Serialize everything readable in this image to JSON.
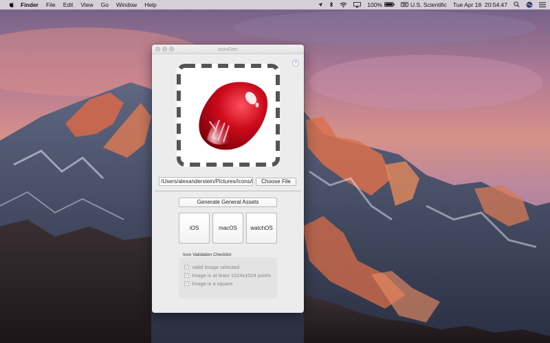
{
  "menubar": {
    "app": "Finder",
    "items": [
      "File",
      "Edit",
      "View",
      "Go",
      "Window",
      "Help"
    ],
    "status": {
      "battery": "100%",
      "input_source": "U.S. Scientific",
      "datetime": "Tue Apr 18  20:54:47"
    }
  },
  "window": {
    "title": "iconGen",
    "help": "?",
    "path_value": "/Users/alexanderstein/Pictures/Icons/ic",
    "choose_file": "Choose File",
    "generate_general": "Generate General Assets",
    "platforms": [
      "iOS",
      "macOS",
      "watchOS"
    ],
    "checklist": {
      "title": "Icon Validation Checklist",
      "items": [
        {
          "label": "Valid Image selected",
          "checked": true
        },
        {
          "label": "Image is at least 1024x1024 pixels",
          "checked": true
        },
        {
          "label": "Image is a square",
          "checked": true
        }
      ]
    }
  },
  "colors": {
    "icon_red": "#cc0a1a",
    "link_blue": "#3b7fe0"
  }
}
